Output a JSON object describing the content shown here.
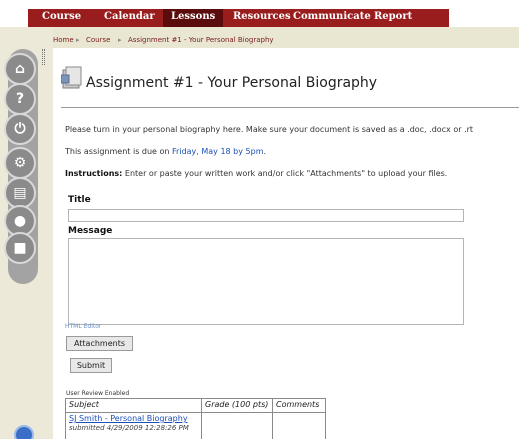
{
  "nav": {
    "items": [
      "Course",
      "Calendar",
      "Lessons",
      "Resources",
      "Communicate",
      "Report"
    ],
    "active_index": 2
  },
  "breadcrumb": [
    "Home",
    "Course",
    "Assignment #1 - Your Personal Biography"
  ],
  "page": {
    "title": "Assignment #1 - Your Personal Biography",
    "instructions_line1": "Please turn in your personal biography here.  Make sure your document is saved as a .doc, .docx or .rt",
    "due_prefix": "This assignment is due on ",
    "due_date": "Friday, May 18 by 5pm",
    "due_suffix": ".",
    "instructions_label": "Instructions:",
    "instructions_text": " Enter or paste your written work and/or click \"Attachments\" to upload your files."
  },
  "form": {
    "title_label": "Title",
    "title_value": "",
    "message_label": "Message",
    "message_value": "",
    "html_editor_link": "HTML Editor",
    "attachments_button": "Attachments",
    "submit_button": "Submit"
  },
  "review": {
    "label": "User Review Enabled",
    "columns": [
      "Subject",
      "Grade (100 pts)",
      "Comments"
    ],
    "rows": [
      {
        "subject": "SJ Smith - Personal Biography",
        "submitted": "submitted 4/29/2009 12:28:26 PM",
        "grade": "",
        "comments": ""
      }
    ]
  },
  "icons": {
    "rail": [
      "home-icon",
      "help-icon",
      "power-icon",
      "gear-icon",
      "folder-icon",
      "person-icon",
      "chat-icon"
    ],
    "accent": "#9a1d1d"
  }
}
